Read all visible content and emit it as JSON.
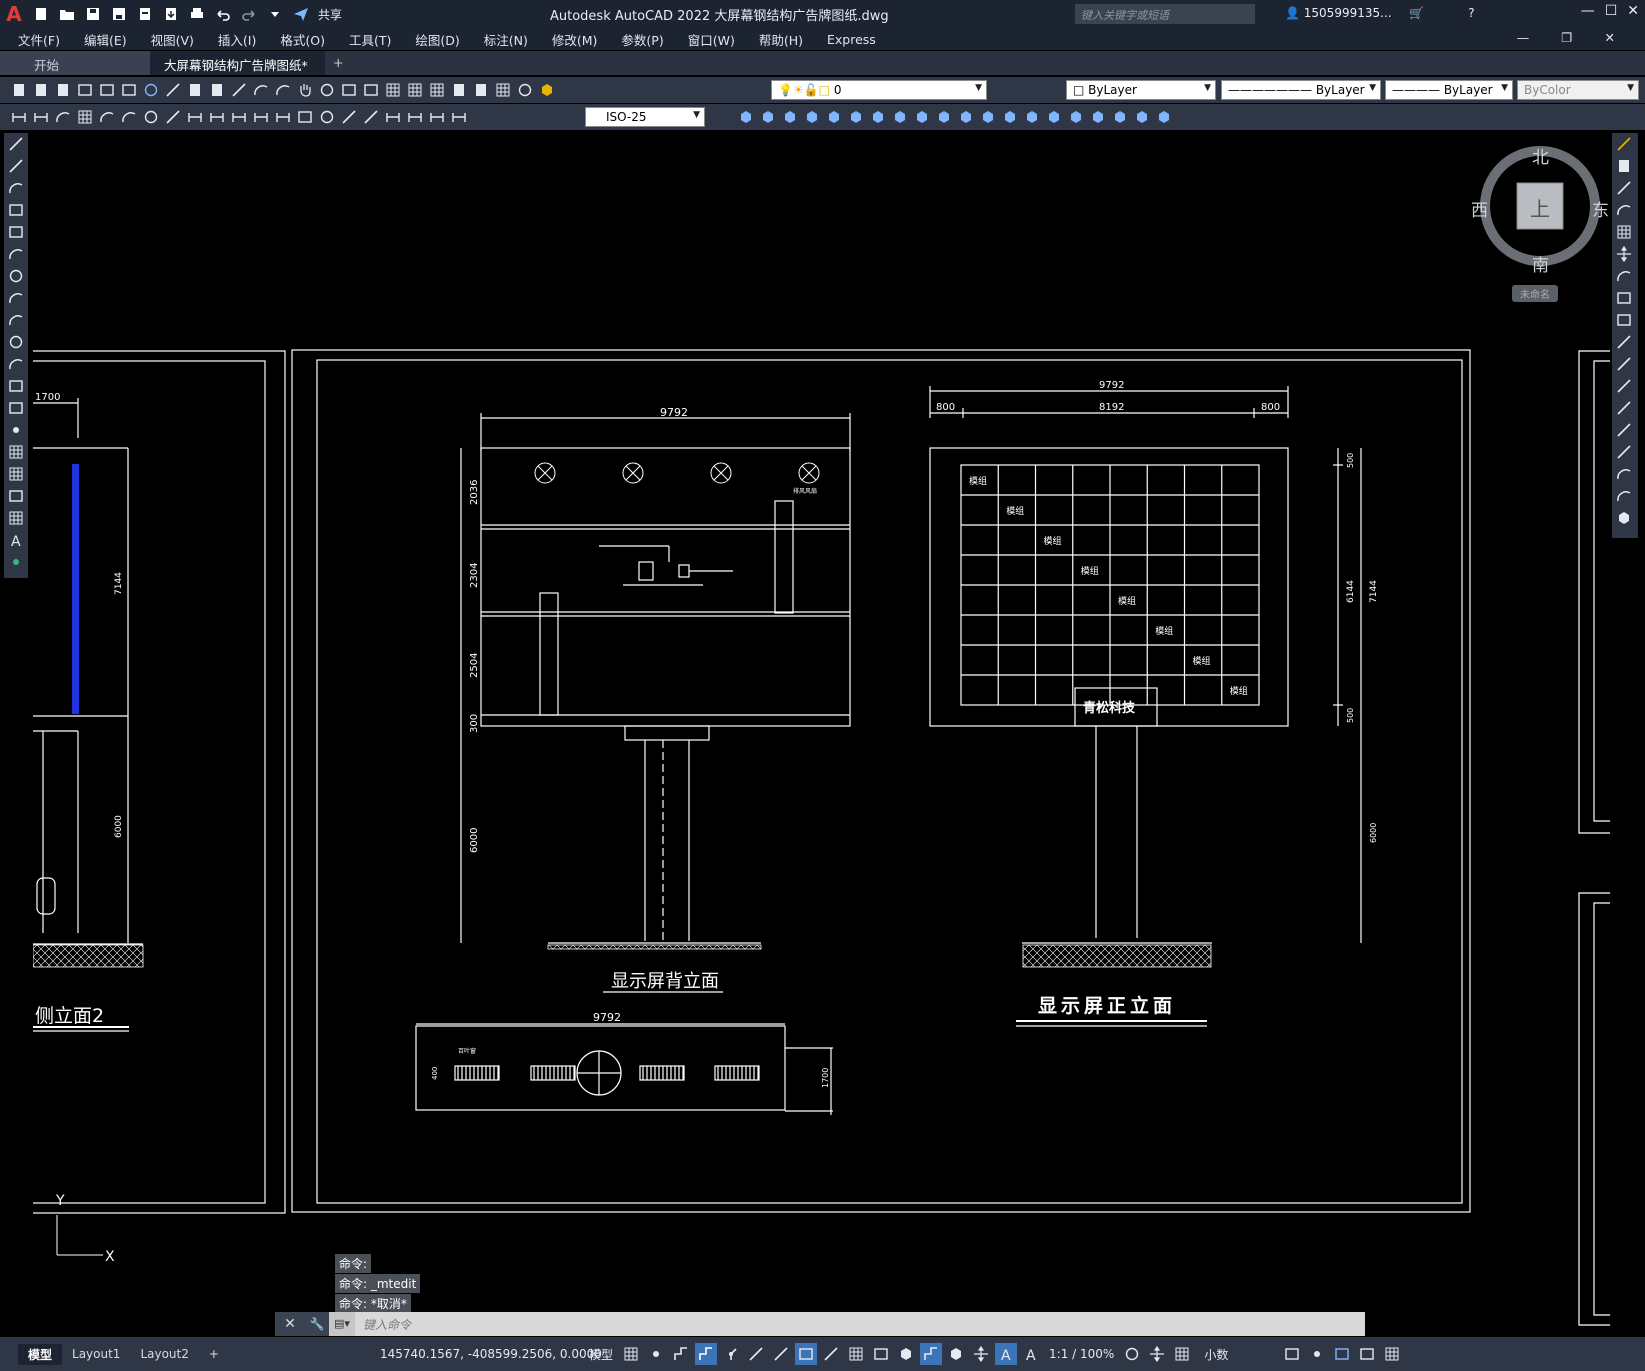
{
  "app": {
    "logo": "A",
    "title": "Autodesk AutoCAD 2022    大屏幕钢结构广告牌图纸.dwg",
    "share_label": "共享",
    "search_placeholder": "键入关键字或短语",
    "user": "1505999135...",
    "window_controls": [
      "—",
      "☐",
      "✕"
    ],
    "mdi_controls": [
      "—",
      "❐",
      "✕"
    ]
  },
  "menu": [
    "文件(F)",
    "编辑(E)",
    "视图(V)",
    "插入(I)",
    "格式(O)",
    "工具(T)",
    "绘图(D)",
    "标注(N)",
    "修改(M)",
    "参数(P)",
    "窗口(W)",
    "帮助(H)",
    "Express"
  ],
  "tabs": {
    "start": "开始",
    "active": "大屏幕钢结构广告牌图纸*",
    "close": "✕",
    "add": "+"
  },
  "properties": {
    "layer": "0",
    "color": "ByLayer",
    "linetype": "ByLayer",
    "lineweight": "ByLayer",
    "plotstyle": "ByColor",
    "dimstyle": "ISO-25"
  },
  "viewcube": {
    "north": "北",
    "south": "南",
    "east": "东",
    "west": "西",
    "face": "上",
    "ucs": "未命名"
  },
  "drawing": {
    "left_side_title": "侧立面2",
    "left_dims": [
      "1700",
      "7144",
      "6000"
    ],
    "back_title": "显示屏背立面",
    "back_dims": [
      "9792",
      "2036",
      "2304",
      "2504",
      "300",
      "6000"
    ],
    "front_title": "显示屏正立面",
    "front_dims": [
      "9792",
      "800",
      "8192",
      "800",
      "500",
      "6144",
      "7144",
      "500",
      "6000"
    ],
    "module_label": "模组",
    "brand_text": "青松科技",
    "fan_note": "排风风扇",
    "plan_dims": [
      "9792",
      "1700",
      "400"
    ],
    "plan_note": "百叶窗"
  },
  "ucs_icon": {
    "y": "Y",
    "x": "X"
  },
  "command": {
    "history": [
      "命令:",
      "命令: _mtedit",
      "命令: *取消*"
    ],
    "placeholder": "键入命令"
  },
  "status": {
    "tabs": [
      "模型",
      "Layout1",
      "Layout2"
    ],
    "add": "+",
    "coords": "145740.1567, -408599.2506, 0.0000",
    "model": "模型",
    "scale": "1:1 / 100%",
    "units": "小数"
  },
  "colors": {
    "accent": "#3c74b8",
    "canvas": "#000000",
    "chrome": "#2f3747",
    "titlebar": "#1d2431",
    "blue_panel": "#2233dd"
  }
}
